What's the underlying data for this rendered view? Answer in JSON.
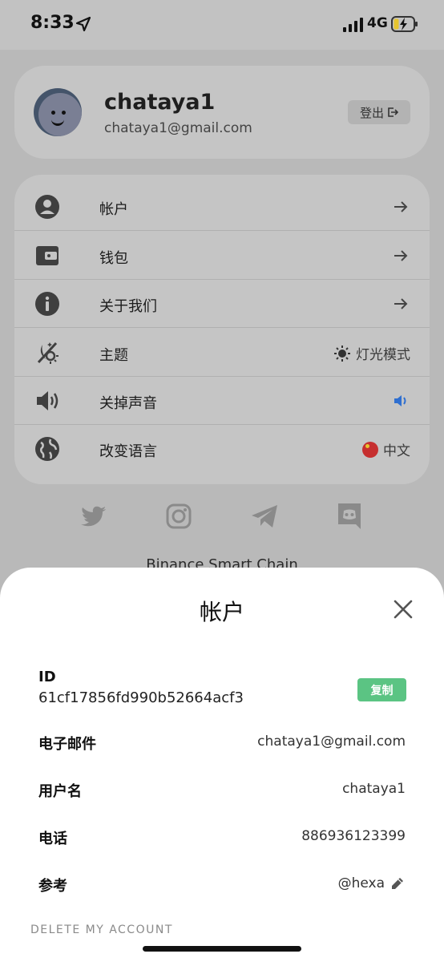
{
  "status_bar": {
    "time": "8:33",
    "network": "4G"
  },
  "profile": {
    "name": "chataya1",
    "email": "chataya1@gmail.com",
    "logout_label": "登出"
  },
  "menu": {
    "items": [
      {
        "label": "帐户",
        "icon": "user-circle-icon",
        "trailing": "arrow"
      },
      {
        "label": "钱包",
        "icon": "wallet-icon",
        "trailing": "arrow"
      },
      {
        "label": "关于我们",
        "icon": "info-icon",
        "trailing": "arrow"
      },
      {
        "label": "主题",
        "icon": "theme-icon",
        "trailing_text": "灯光模式"
      },
      {
        "label": "关掉声音",
        "icon": "speaker-icon",
        "trailing": "volume"
      },
      {
        "label": "改变语言",
        "icon": "globe-icon",
        "trailing_text": "中文"
      }
    ]
  },
  "social": [
    "twitter-icon",
    "instagram-icon",
    "telegram-icon",
    "discord-icon"
  ],
  "chain_label": "Binance Smart Chain",
  "sheet": {
    "title": "帐户",
    "id_label": "ID",
    "id_value": "61cf17856fd990b52664acf3",
    "copy_label": "复制",
    "fields": [
      {
        "label": "电子邮件",
        "value": "chataya1@gmail.com"
      },
      {
        "label": "用户名",
        "value": "chataya1"
      },
      {
        "label": "电话",
        "value": "886936123399"
      },
      {
        "label": "参考",
        "value": "@hexa"
      }
    ],
    "delete_label": "DELETE MY ACCOUNT"
  },
  "colors": {
    "accent_green": "#5bc483",
    "volume_blue": "#2f6fd0",
    "overlay_gray": "#b9b9b9"
  }
}
